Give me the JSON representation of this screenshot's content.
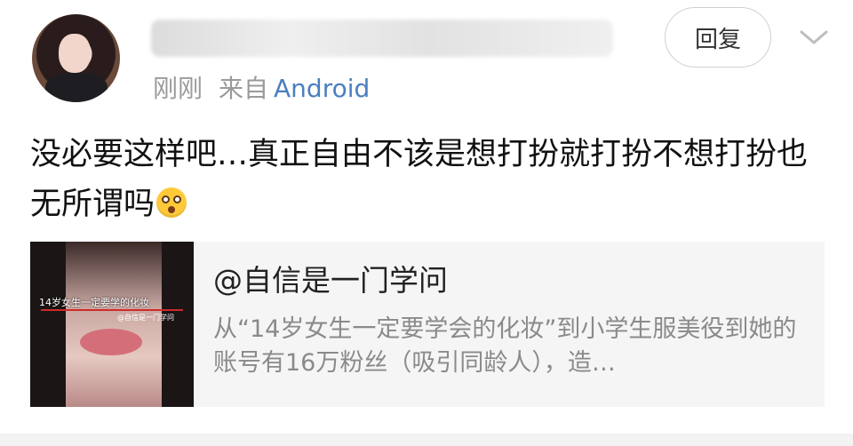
{
  "post": {
    "meta": {
      "time": "刚刚",
      "from": "来自",
      "source": "Android"
    },
    "reply_label": "回复",
    "content_text": "没必要这样吧…真正自由不该是想打扮就打扮不想打扮也无所谓吗",
    "emoji": "flushed-face"
  },
  "quoted_card": {
    "title": "@自信是一门学问",
    "description": "从“14岁女生一定要学会的化妆”到小学生服美役到她的账号有16万粉丝（吸引同龄人），造…",
    "thumbnail": {
      "caption": "14岁女生一定要学的化妆",
      "watermark": "@自信是一门学问"
    }
  },
  "colors": {
    "source_link": "#4a7fc0",
    "muted_text": "#9a9a9a",
    "card_bg": "#f5f5f5"
  }
}
